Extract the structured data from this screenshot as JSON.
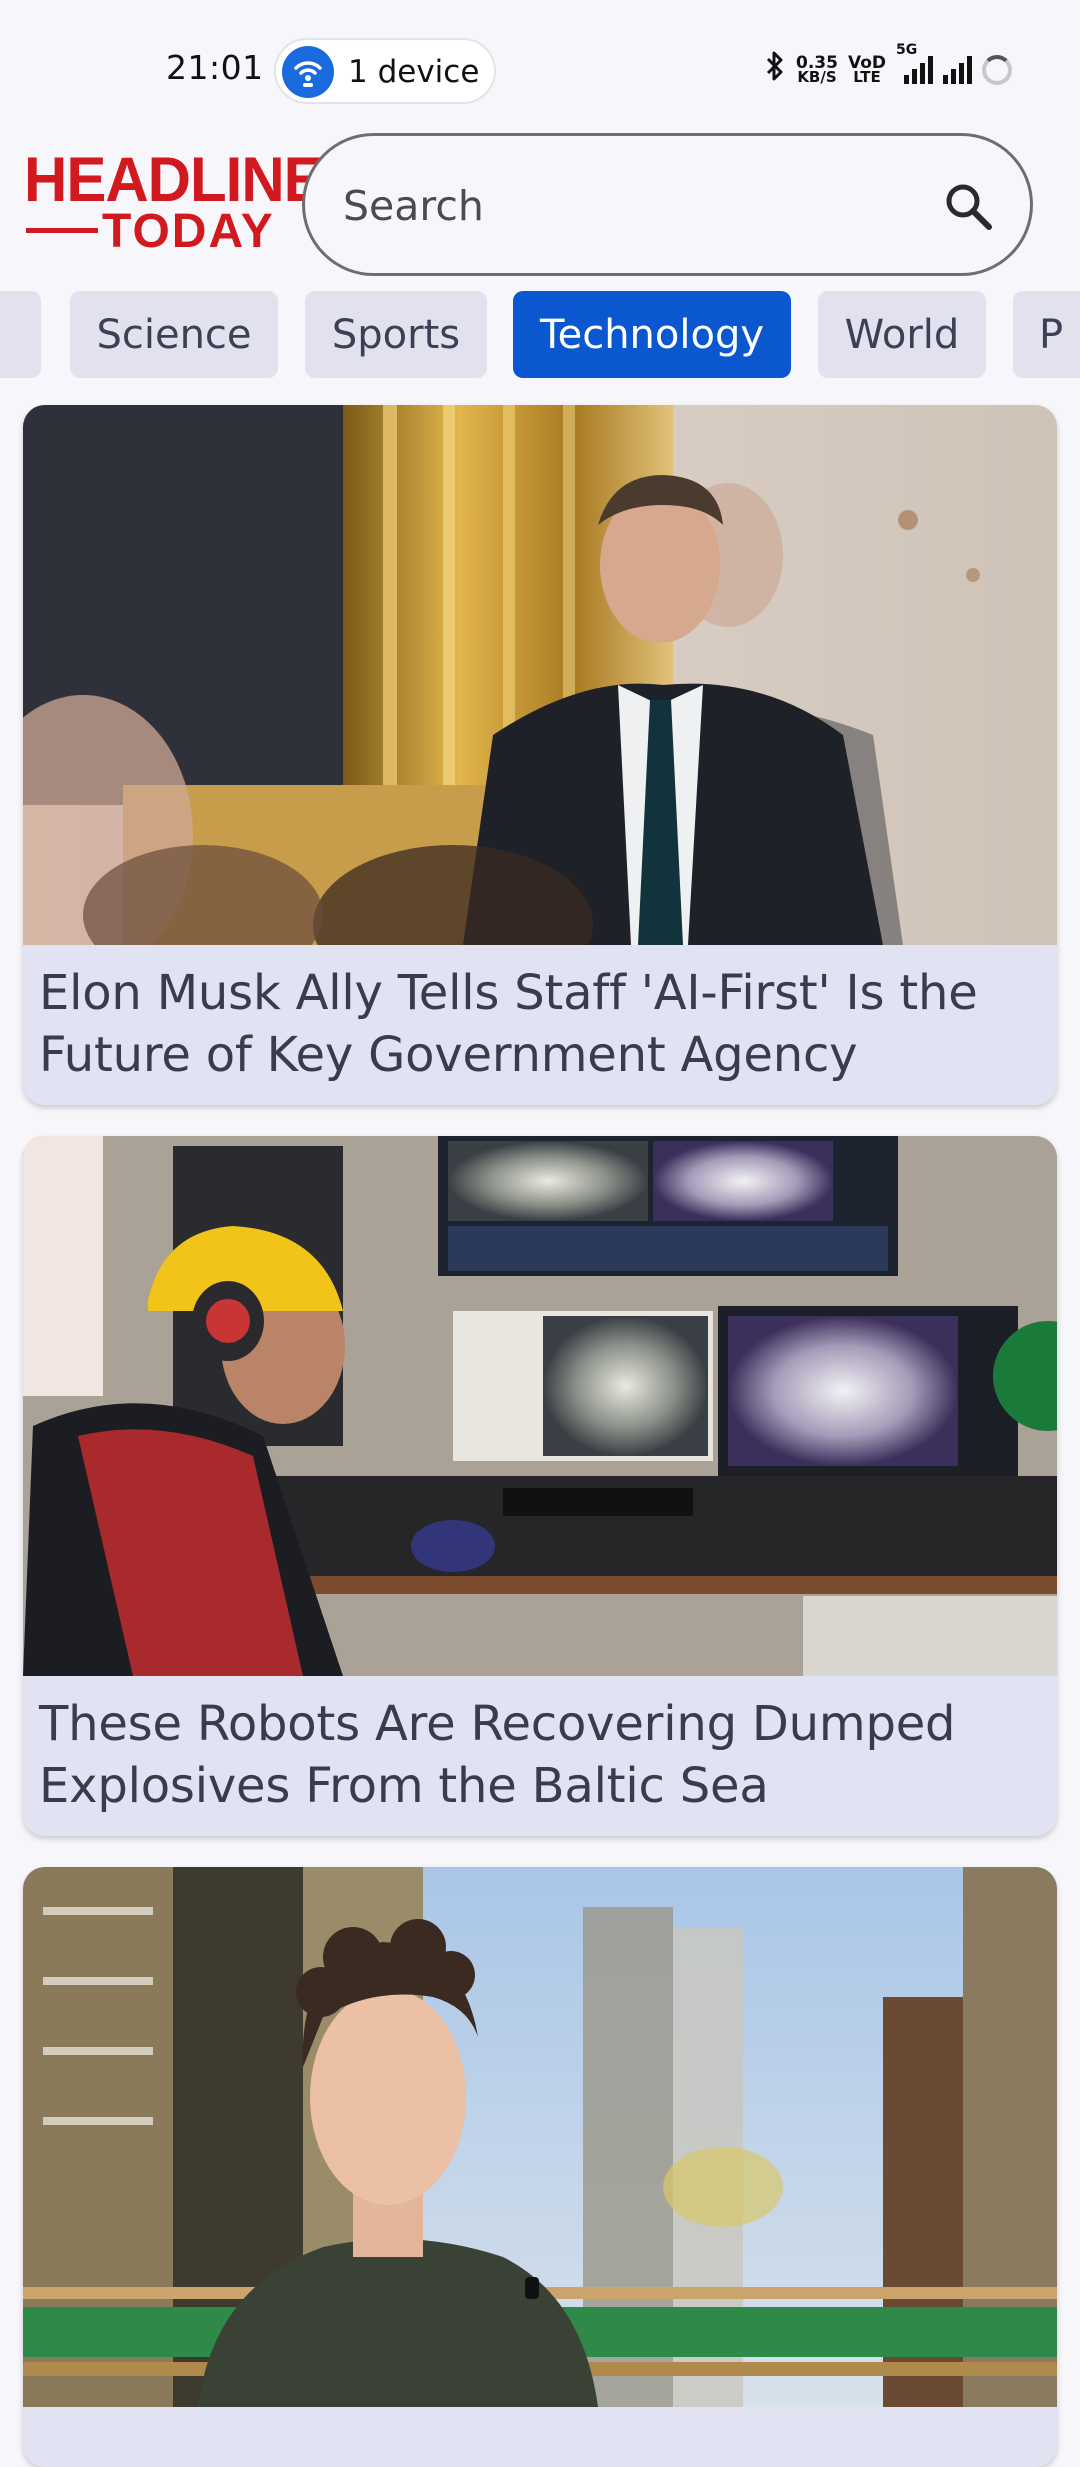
{
  "status_bar": {
    "time": "21:01",
    "hotspot_label": "1 device",
    "data_rate_value": "0.35",
    "data_rate_unit": "KB/S",
    "volte_top": "VoD",
    "volte_bottom": "LTE",
    "network": "5G"
  },
  "header": {
    "logo_line1": "HEADLINES",
    "logo_line2": "TODAY",
    "search_placeholder": "Search"
  },
  "categories": {
    "items": [
      "",
      "Science",
      "Sports",
      "Technology",
      "World",
      "P"
    ],
    "active": "Technology"
  },
  "articles": [
    {
      "title": "Elon Musk Ally Tells Staff 'AI-First' Is the Future of Key Government Agency"
    },
    {
      "title": "These Robots Are Recovering Dumped Explosives From the Baltic Sea"
    },
    {
      "title": ""
    }
  ],
  "colors": {
    "brand_red": "#d11a1f",
    "accent_blue": "#0a57cf",
    "tab_bg": "#e1e2ee",
    "card_bg": "#e1e3f2"
  },
  "icons": {
    "search": "search-icon",
    "hotspot": "wifi-hotspot-icon",
    "bluetooth": "bluetooth-icon",
    "battery": "battery-icon"
  }
}
